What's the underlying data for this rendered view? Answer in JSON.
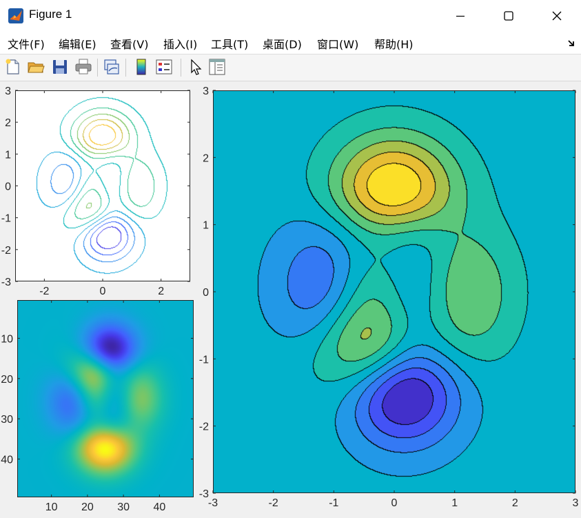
{
  "window": {
    "title": "Figure 1",
    "app_icon": "matlab-icon",
    "controls": [
      "minimize-icon",
      "maximize-icon",
      "close-icon"
    ]
  },
  "menu": {
    "items": [
      "文件(F)",
      "编辑(E)",
      "查看(V)",
      "插入(I)",
      "工具(T)",
      "桌面(D)",
      "窗口(W)",
      "帮助(H)"
    ],
    "dock_icon": "dock-arrow-icon"
  },
  "toolbar": {
    "buttons": [
      "new-figure-icon",
      "open-file-icon",
      "save-icon",
      "print-icon",
      "link-plot-icon",
      "insert-colorbar-icon",
      "insert-legend-icon",
      "edit-plot-icon",
      "property-inspector-icon"
    ]
  },
  "colors": {
    "parula_low": "#3e26a8",
    "parula_mid": "#00b1c3",
    "parula_high": "#f9fb15",
    "contour_line": "#000000"
  },
  "chart_data": [
    {
      "type": "contour",
      "function": "peaks",
      "xlim": [
        -3,
        3
      ],
      "ylim": [
        -3,
        3
      ],
      "xticks": [
        -2,
        0,
        2
      ],
      "yticks": [
        -3,
        -2,
        -1,
        0,
        1,
        2,
        3
      ],
      "colormap": "parula",
      "levels": 10,
      "grid": false
    },
    {
      "type": "heatmap",
      "function": "peaks",
      "size": [
        49,
        49
      ],
      "xticks": [
        10,
        20,
        30,
        40
      ],
      "yticks": [
        10,
        20,
        30,
        40
      ],
      "colormap": "parula",
      "grid": false
    },
    {
      "type": "contourf",
      "function": "peaks",
      "xlim": [
        -3,
        3
      ],
      "ylim": [
        -3,
        3
      ],
      "xticks": [
        -3,
        -2,
        -1,
        0,
        1,
        2,
        3
      ],
      "yticks": [
        -3,
        -2,
        -1,
        0,
        1,
        2,
        3
      ],
      "colormap": "parula",
      "levels": 10,
      "grid": false
    }
  ]
}
